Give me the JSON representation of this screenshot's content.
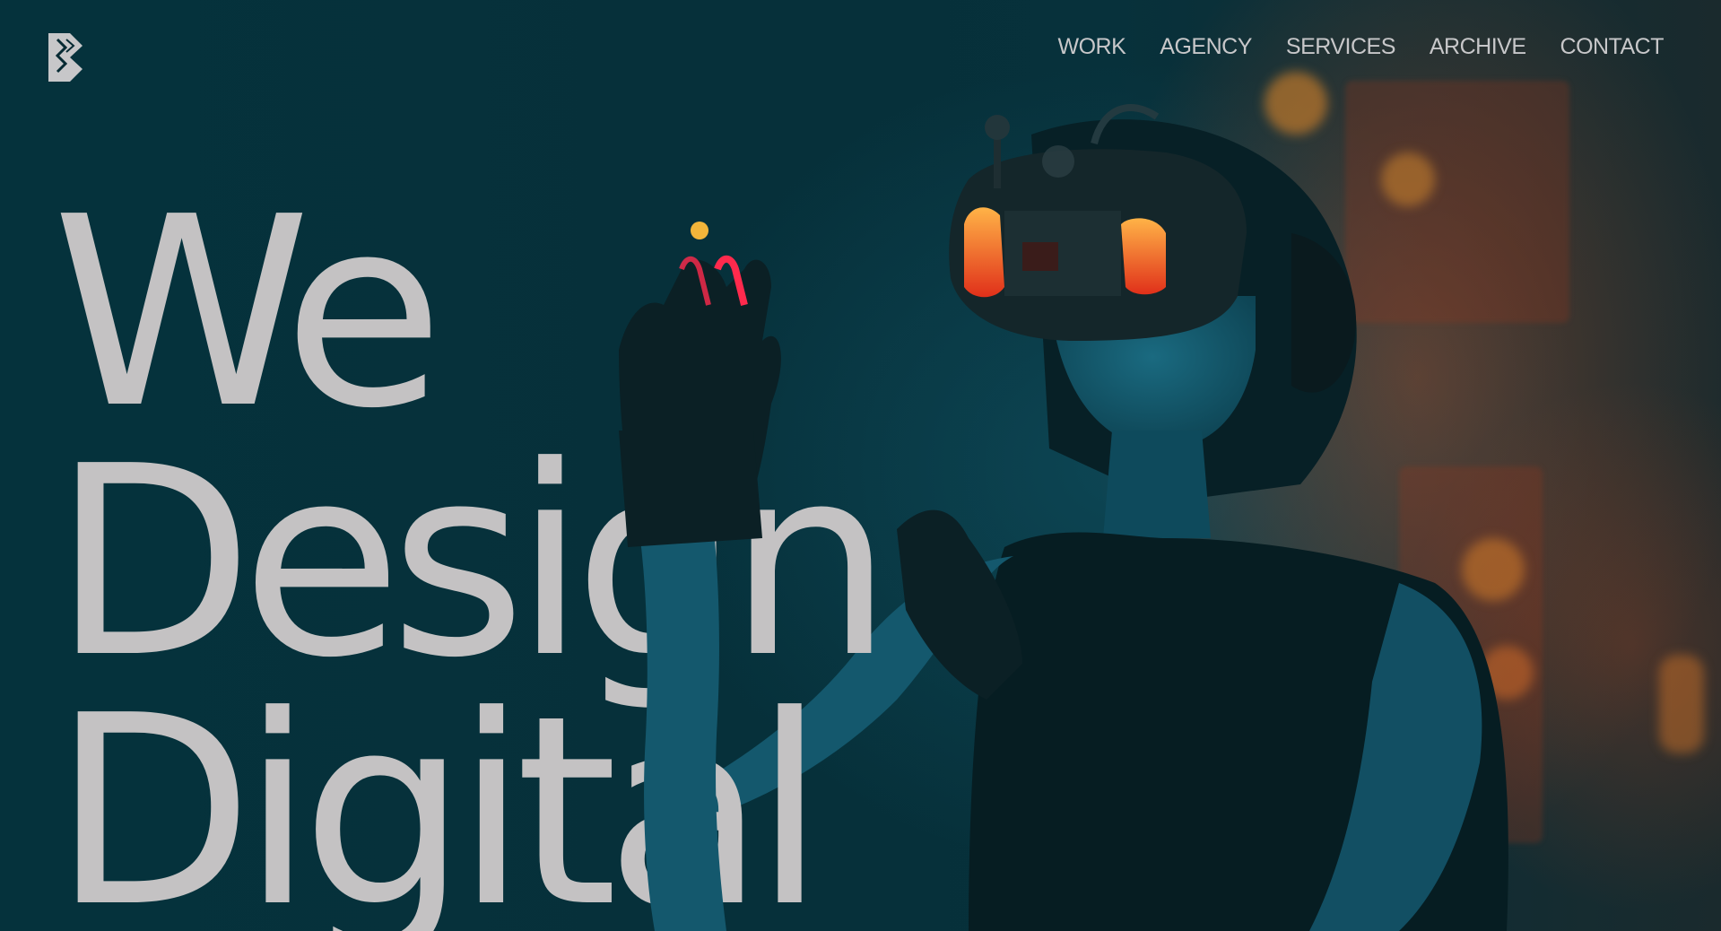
{
  "brand": {
    "logo_icon": "stacked-diamond-logo-icon"
  },
  "nav": {
    "items": [
      {
        "label": "WORK"
      },
      {
        "label": "AGENCY"
      },
      {
        "label": "SERVICES"
      },
      {
        "label": "ARCHIVE"
      },
      {
        "label": "CONTACT"
      }
    ]
  },
  "hero": {
    "headline_lines": [
      "We",
      "Design",
      "Digital"
    ],
    "background_image": "woman-wearing-vr-headset-photo",
    "accent_dot_color": "#f2b53a"
  },
  "colors": {
    "background": "#062a33",
    "text": "#c4c2c3",
    "accent": "#f2b53a"
  }
}
